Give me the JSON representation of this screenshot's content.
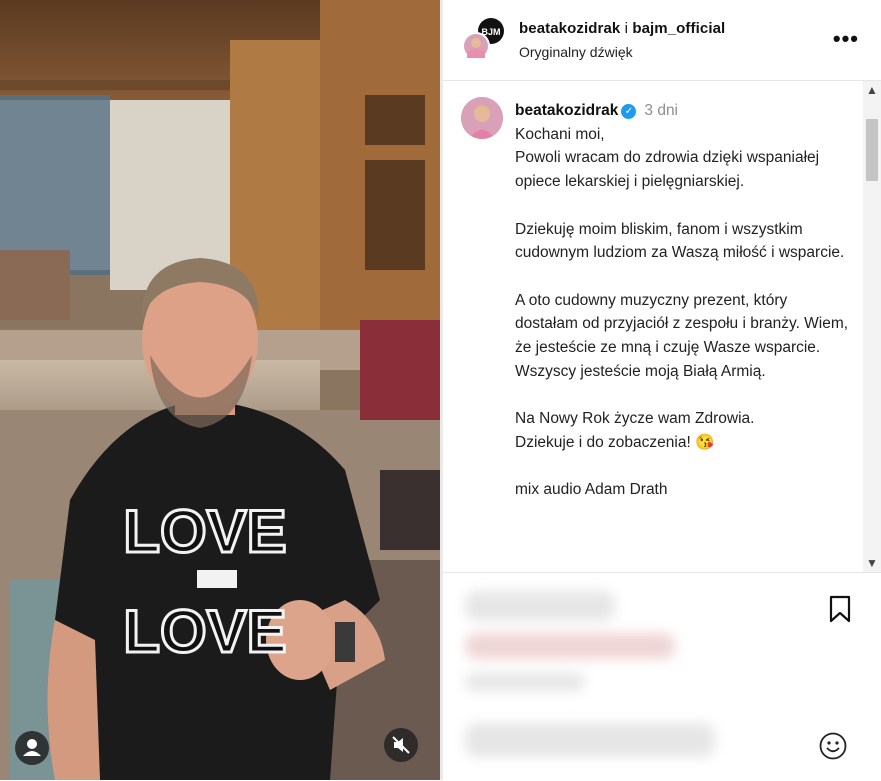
{
  "header": {
    "username": "beatakozidrak",
    "separator": " i ",
    "collaborator": "bajm_official",
    "subtitle": "Oryginalny dźwięk",
    "more_icon": "more-horizontal-icon"
  },
  "post": {
    "author": "beatakozidrak",
    "verified_icon": "verified-badge-icon",
    "time": "3 dni",
    "caption": "Kochani moi,\nPowoli wracam do zdrowia dzięki wspaniałej opiece lekarskiej i pielęgniarskiej.\n\nDziekuję moim bliskim, fanom i wszystkim cudownym ludziom za Waszą miłość i wsparcie.\n\nA oto cudowny muzyczny prezent, który dostałam od przyjaciół z zespołu i branży. Wiem, że jesteście ze mną i czuję Wasze wsparcie.\nWszyscy jesteście moją Białą Armią.\n\nNa Nowy Rok życze wam Zdrowia.\nDziekuje i do zobaczenia! 😘\n\nmix audio Adam Drath"
  },
  "video": {
    "shirt_top": "LOVE",
    "shirt_bottom": "LOVE",
    "user_icon": "user-icon",
    "mute_icon": "sound-off-icon"
  },
  "actions": {
    "bookmark_icon": "bookmark-icon",
    "emoji_icon": "emoji-icon"
  },
  "colors": {
    "verified": "#1d9bf0",
    "text": "#222222",
    "muted": "#8e8e8e"
  }
}
